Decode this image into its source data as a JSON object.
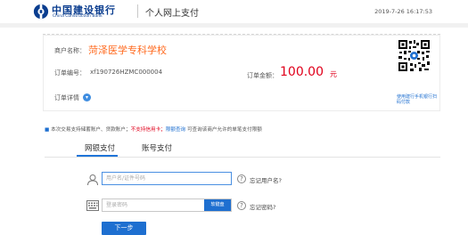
{
  "header": {
    "bank_name_cn": "中国建设银行",
    "bank_name_en": "China Construction Bank",
    "title": "个人网上支付",
    "timestamp": "2019-7-26 16:17:53"
  },
  "order": {
    "merchant_label": "商户名称：",
    "merchant_name": "菏泽医学专科学校",
    "order_no_label": "订单编号：",
    "order_no": "xf190726HZMC000004",
    "amount_label": "订单金额：",
    "amount": "100.00",
    "amount_unit": "元",
    "detail_label": "订单详情",
    "qr_caption": "使用建行手机银行扫码付款"
  },
  "notice": {
    "part1": "本次交易支持储蓄账户、贷款账户；",
    "part2": "不支持信用卡；",
    "part3": "限额查询",
    "part4": "可查询该商户允许的单笔支付限额"
  },
  "tabs": [
    {
      "label": "网银支付",
      "active": true
    },
    {
      "label": "账号支付",
      "active": false
    }
  ],
  "form": {
    "username_placeholder": "用户名/证件号码",
    "forgot_username": "忘记用户名?",
    "password_placeholder": "登录密码",
    "soft_keyboard": "软键盘",
    "forgot_password": "忘记密码?",
    "next_button": "下一步"
  },
  "colors": {
    "brand_blue": "#1e6fd0",
    "amount_red": "#e0001b",
    "merchant_orange": "#ff6a1f"
  }
}
